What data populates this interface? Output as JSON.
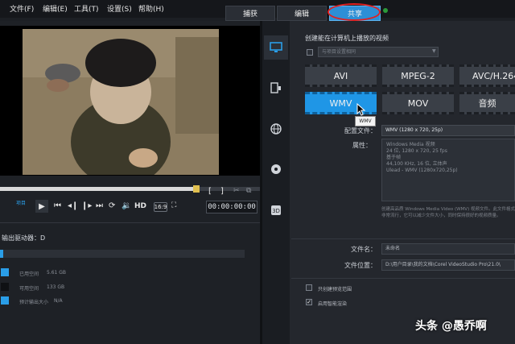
{
  "menu": [
    "文件(F)",
    "编辑(E)",
    "工具(T)",
    "设置(S)",
    "帮助(H)"
  ],
  "tabs": {
    "capture": "捕获",
    "edit": "编辑",
    "share": "共享"
  },
  "player": {
    "mark": "项目",
    "hd": "HD",
    "aspect": "16:9",
    "timecode": "00:00:00:00",
    "bracket_in": "[",
    "bracket_out": "]"
  },
  "drive": {
    "title": "输出驱动器：D",
    "legend": [
      {
        "label": "已用空间",
        "value": "5.61 GB",
        "color": "#2a9ee8"
      },
      {
        "label": "可用空间",
        "value": "133 GB",
        "color": "#2c3037"
      },
      {
        "label": "预计输出大小",
        "value": "N/A",
        "color": "#2a9ee8"
      }
    ]
  },
  "share": {
    "heading": "创建能在计算机上播放的视频",
    "dest_placeholder": "与项目设置相同",
    "formats_row1": [
      "AVI",
      "MPEG-2",
      "AVC/H.264"
    ],
    "formats_row2": [
      "WMV",
      "MOV",
      "音频"
    ],
    "selected": "WMV",
    "tooltip": "WMV",
    "profile_label": "配置文件：",
    "profile_value": "WMV (1280 x 720, 25p)",
    "props_label": "属性：",
    "props_lines": [
      "Windows Media 视频",
      "24 位, 1280 x 720, 25 fps",
      "基于帧",
      "44,100 KHz, 16 位, 立体声",
      "Ulead - WMV (1280x720,25p)"
    ],
    "desc": "创建高品质 Windows Media Video (WMV) 视频文件。此文件格式非常流行，它可以减少文件大小，同时保持很好的视频质量。",
    "filename_label": "文件名：",
    "filename_value": "未命名",
    "filepath_label": "文件位置：",
    "filepath_value": "D:\\用户目录\\我的文档\\Corel VideoStudio Pro\\21.0\\",
    "option1": "只创建预览范围",
    "option2": "启用智能渲染"
  },
  "watermark": "头条 @愚乔啊",
  "colors": {
    "accent": "#1f96e6",
    "highlight": "#e02020"
  }
}
